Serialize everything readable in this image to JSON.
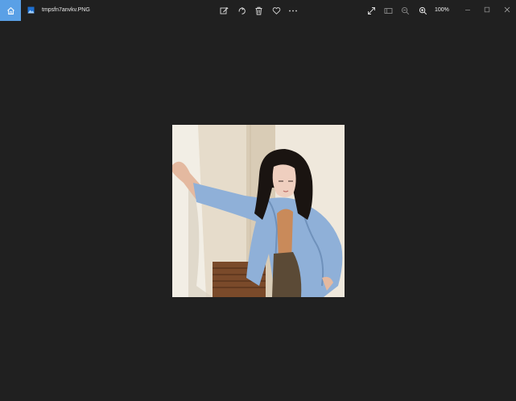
{
  "window": {
    "filename": "tmpsfn7anvkv.PNG",
    "zoom_level": "100%"
  },
  "toolbar": {
    "icons": [
      "edit-icon",
      "rotate-icon",
      "delete-icon",
      "favorite-icon",
      "more-icon"
    ]
  },
  "right_tools": {
    "icons": [
      "fullscreen-icon",
      "filmstrip-icon",
      "zoom-out-icon",
      "zoom-in-icon"
    ]
  },
  "window_controls": {
    "icons": [
      "minimize-icon",
      "maximize-icon",
      "close-icon"
    ]
  },
  "colors": {
    "background": "#202020",
    "home_accent": "#5aa0e6"
  }
}
